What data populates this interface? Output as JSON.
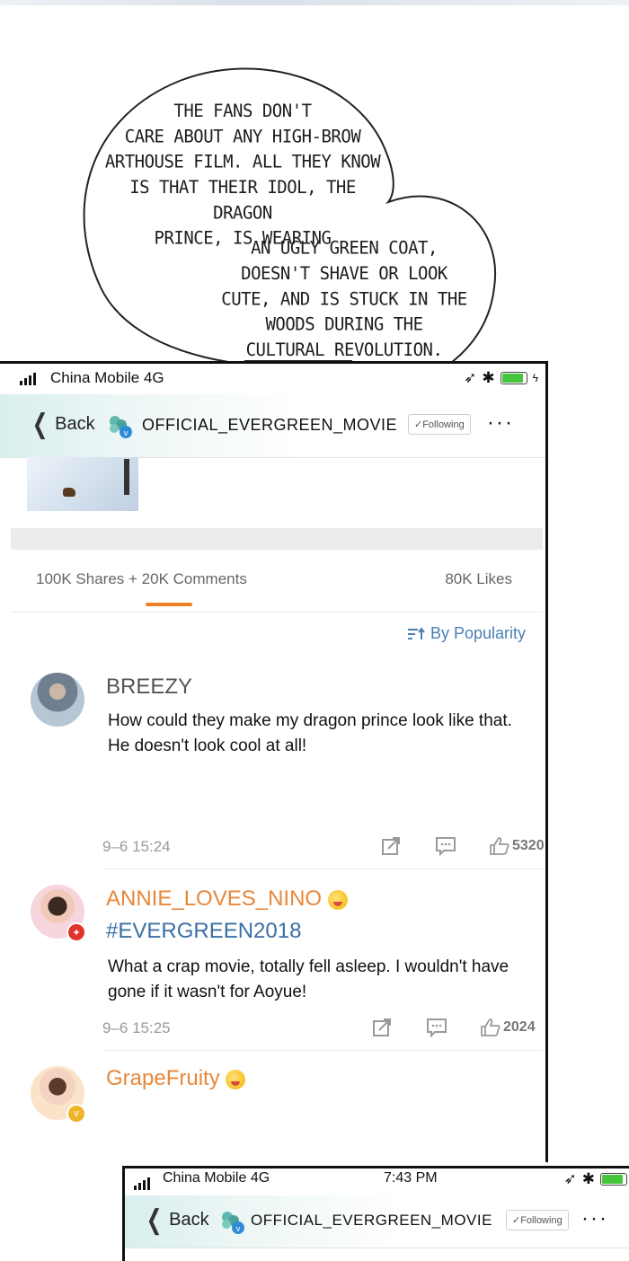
{
  "speech_bubble": {
    "line_group_1": "THE FANS DON'T\nCARE ABOUT ANY HIGH-BROW\nARTHOUSE FILM. ALL THEY KNOW\nIS THAT THEIR IDOL, THE DRAGON\nPRINCE, IS WEARING",
    "line_group_2": "AN UGLY GREEN COAT,\nDOESN'T SHAVE OR LOOK\nCUTE, AND IS STUCK IN THE\nWOODS DURING THE\nCULTURAL REVOLUTION."
  },
  "phone_1": {
    "status": {
      "carrier": "China Mobile 4G",
      "time": ""
    },
    "nav": {
      "back_label": "Back",
      "account_name": "OFFICIAL_EVERGREEN_MOVIE",
      "follow_label": "✓Following",
      "more_label": "···"
    },
    "stats": {
      "shares_comments": "100K Shares + 20K Comments",
      "likes": "80K Likes"
    },
    "sort_label": "By Popularity",
    "comments": [
      {
        "username": "BREEZY",
        "tag": "",
        "text": "How could they make my dragon prince look like that. He doesn't look cool at all!",
        "time": "9–6 15:24",
        "likes": "5320",
        "username_color": "#555555"
      },
      {
        "username": "ANNIE_LOVES_NINO",
        "tag": "#EVERGREEN2018",
        "text": "What a crap movie, totally fell asleep. I wouldn't have gone if it wasn't for Aoyue!",
        "time": "9–6 15:25",
        "likes": "2024",
        "username_color": "#e8873a"
      },
      {
        "username": "GrapeFruity",
        "username_color": "#e8873a"
      }
    ]
  },
  "phone_2": {
    "status": {
      "carrier": "China Mobile 4G",
      "time": "7:43 PM"
    },
    "nav": {
      "back_label": "Back",
      "account_name": "OFFICIAL_EVERGREEN_MOVIE",
      "follow_label": "✓Following",
      "more_label": "···"
    }
  },
  "colors": {
    "accent_orange": "#f07f23",
    "link_blue": "#4a7fb3",
    "battery_green": "#46c43c"
  },
  "icons": [
    "signal-icon",
    "location-arrow-icon",
    "bluetooth-icon",
    "battery-icon",
    "chevron-left-icon",
    "account-logo-icon",
    "sort-icon",
    "share-icon",
    "comment-icon",
    "thumbs-up-icon",
    "verified-badge-icon",
    "emoji-icon"
  ]
}
